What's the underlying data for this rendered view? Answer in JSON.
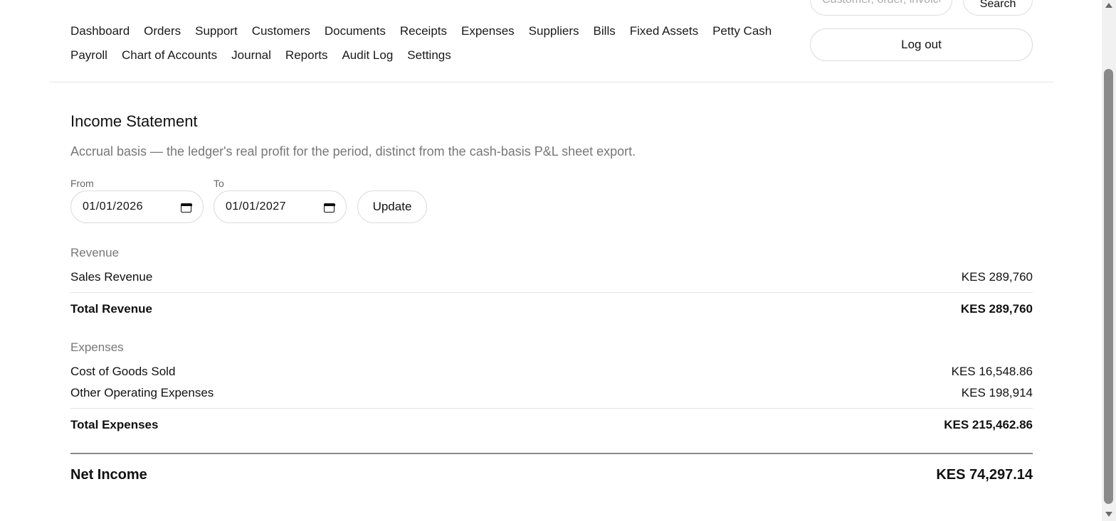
{
  "header": {
    "search_placeholder": "Customer, order, invoice",
    "search_button": "Search",
    "logout_button": "Log out",
    "nav_row_1": [
      "Dashboard",
      "Orders",
      "Support",
      "Customers",
      "Documents",
      "Receipts",
      "Expenses",
      "Suppliers",
      "Bills",
      "Fixed Assets",
      "Petty Cash"
    ],
    "nav_row_2": [
      "Payroll",
      "Chart of Accounts",
      "Journal",
      "Reports",
      "Audit Log",
      "Settings"
    ]
  },
  "report": {
    "title": "Income Statement",
    "subtitle": "Accrual basis — the ledger's real profit for the period, distinct from the cash-basis P&L sheet export.",
    "from_label": "From",
    "from_value": "01/01/2026",
    "to_label": "To",
    "to_value": "01/01/2027",
    "update_button": "Update",
    "revenue": {
      "heading": "Revenue",
      "lines": [
        {
          "label": "Sales Revenue",
          "amount": "KES 289,760"
        }
      ],
      "total_label": "Total Revenue",
      "total_amount": "KES 289,760"
    },
    "expenses": {
      "heading": "Expenses",
      "lines": [
        {
          "label": "Cost of Goods Sold",
          "amount": "KES 16,548.86"
        },
        {
          "label": "Other Operating Expenses",
          "amount": "KES 198,914"
        }
      ],
      "total_label": "Total Expenses",
      "total_amount": "KES 215,462.86"
    },
    "net_income_label": "Net Income",
    "net_income_amount": "KES 74,297.14"
  },
  "icons": {
    "calendar": "calendar-icon",
    "scroll_up": "chevron-up-icon",
    "scroll_down": "chevron-down-icon"
  }
}
